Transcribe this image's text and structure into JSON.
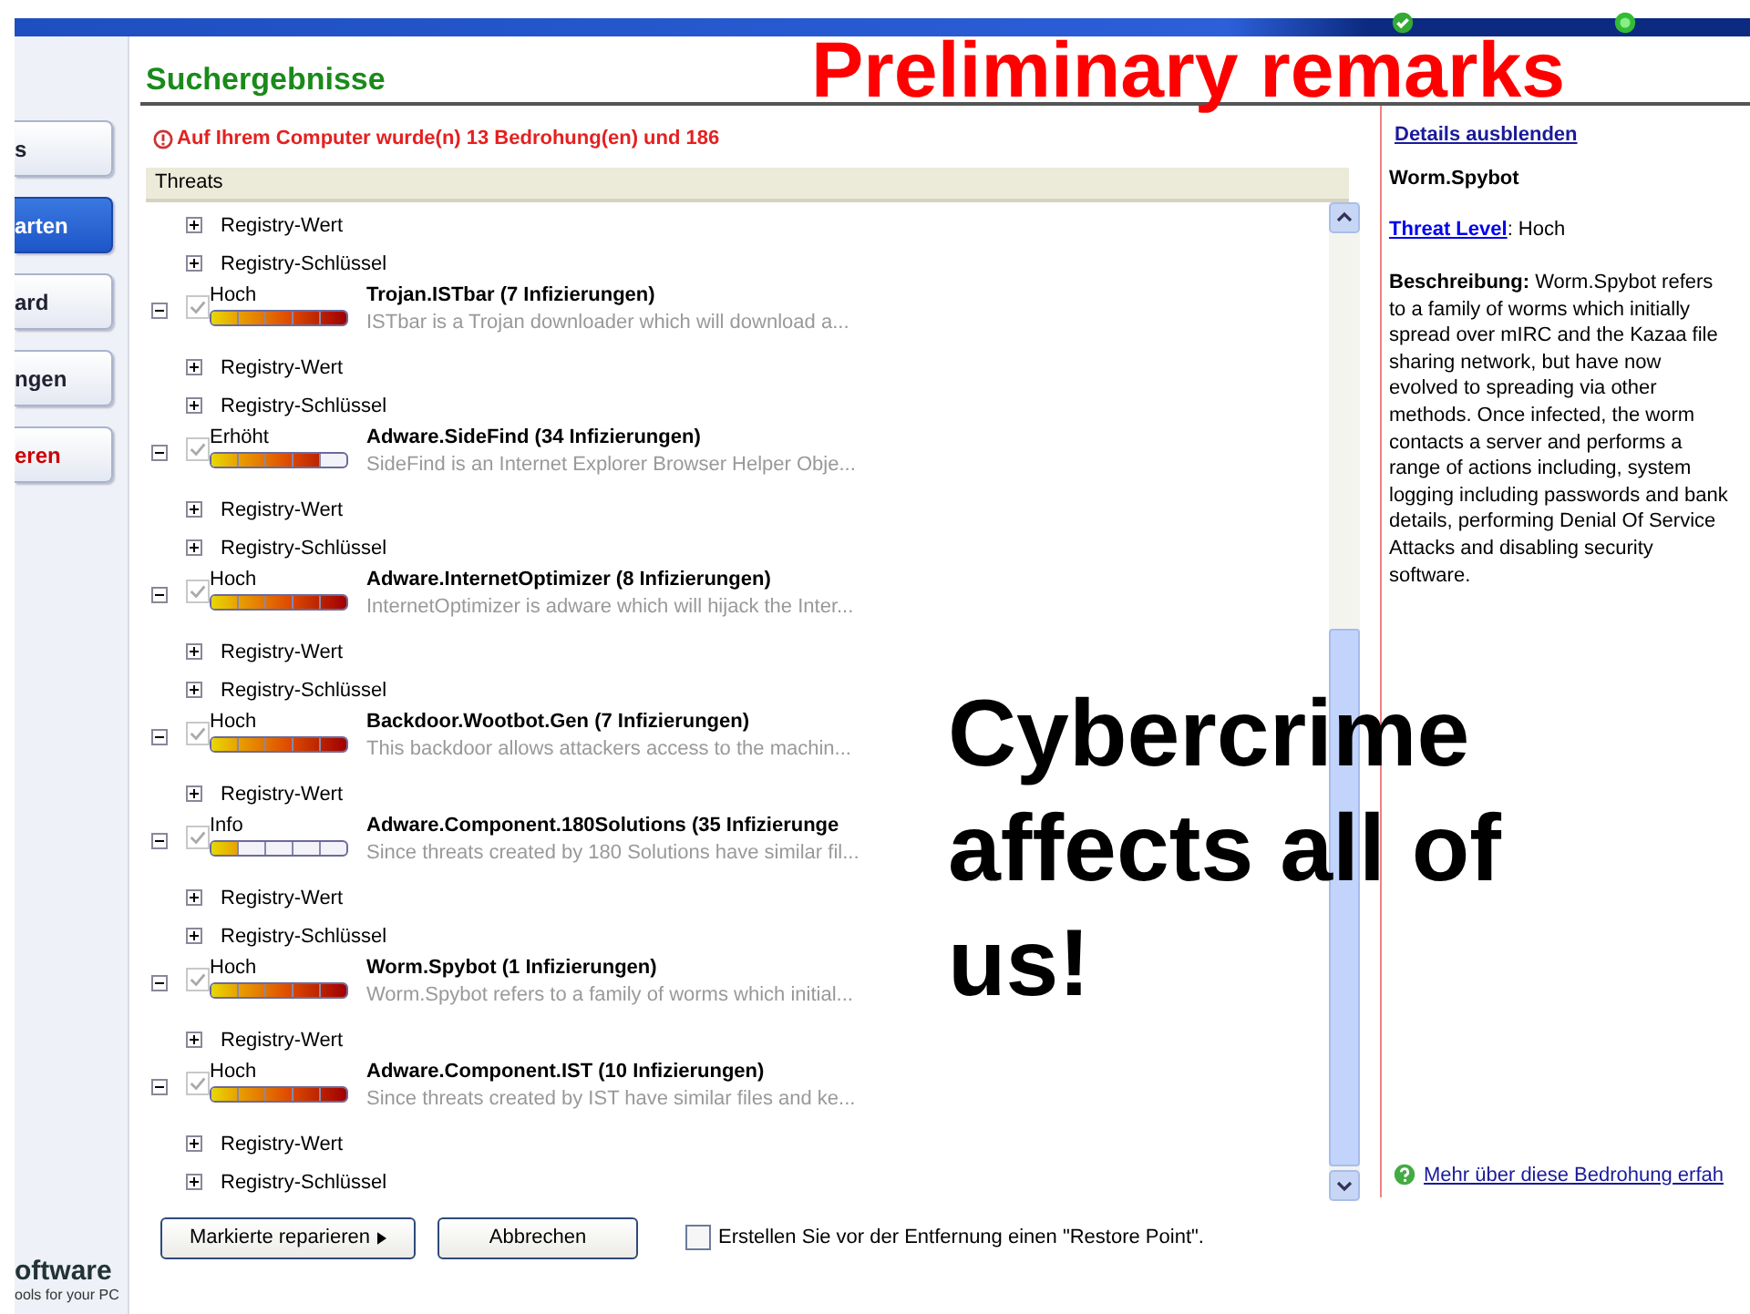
{
  "slide_title": "Preliminary remarks",
  "overlay_text": "Cybercrime affects all of us!",
  "sidebar": {
    "items": [
      {
        "label": "s",
        "selected": false,
        "kind": "normal"
      },
      {
        "label": "arten",
        "selected": true,
        "kind": "normal"
      },
      {
        "label": "ard",
        "selected": false,
        "kind": "normal"
      },
      {
        "label": "ngen",
        "selected": false,
        "kind": "normal"
      },
      {
        "label": "eren",
        "selected": false,
        "kind": "danger"
      }
    ],
    "logo": "oftware",
    "tagline": "ools for your PC"
  },
  "page_title": "Suchergebnisse",
  "warning": "Auf Ihrem Computer wurde(n) 13 Bedrohung(en) und 186",
  "table": {
    "column": "Threats",
    "rows": [
      {
        "kind": "registry",
        "label": "Registry-Wert"
      },
      {
        "kind": "registry",
        "label": "Registry-Schlüssel"
      },
      {
        "kind": "threat",
        "checked": true,
        "severity": "Hoch",
        "level": 1,
        "name": "Trojan.ISTbar (7 Infizierungen)",
        "description": "ISTbar is a Trojan downloader which will download a..."
      },
      {
        "kind": "registry",
        "label": "Registry-Wert"
      },
      {
        "kind": "registry",
        "label": "Registry-Schlüssel"
      },
      {
        "kind": "threat",
        "checked": true,
        "severity": "Erhöht",
        "level": 0.8,
        "name": "Adware.SideFind (34 Infizierungen)",
        "description": "SideFind is an Internet Explorer Browser Helper Obje..."
      },
      {
        "kind": "registry",
        "label": "Registry-Wert"
      },
      {
        "kind": "registry",
        "label": "Registry-Schlüssel"
      },
      {
        "kind": "threat",
        "checked": true,
        "severity": "Hoch",
        "level": 1,
        "name": "Adware.InternetOptimizer (8 Infizierungen)",
        "description": "InternetOptimizer is adware which will hijack the Inter..."
      },
      {
        "kind": "registry",
        "label": "Registry-Wert"
      },
      {
        "kind": "registry",
        "label": "Registry-Schlüssel"
      },
      {
        "kind": "threat",
        "checked": true,
        "severity": "Hoch",
        "level": 1,
        "name": "Backdoor.Wootbot.Gen (7 Infizierungen)",
        "description": "This backdoor allows attackers access to the machin..."
      },
      {
        "kind": "registry",
        "label": "Registry-Wert"
      },
      {
        "kind": "threat",
        "checked": true,
        "severity": "Info",
        "level": 0.2,
        "name": "Adware.Component.180Solutions (35 Infizierunge",
        "description": "Since threats created by 180 Solutions have similar fil..."
      },
      {
        "kind": "registry",
        "label": "Registry-Wert"
      },
      {
        "kind": "registry",
        "label": "Registry-Schlüssel"
      },
      {
        "kind": "threat",
        "checked": true,
        "severity": "Hoch",
        "level": 1,
        "name": "Worm.Spybot (1 Infizierungen)",
        "description": "Worm.Spybot refers to a family of worms which initial..."
      },
      {
        "kind": "registry",
        "label": "Registry-Wert"
      },
      {
        "kind": "threat",
        "checked": true,
        "severity": "Hoch",
        "level": 1,
        "name": "Adware.Component.IST (10 Infizierungen)",
        "description": "Since threats created by IST have similar files and ke..."
      },
      {
        "kind": "registry",
        "label": "Registry-Wert"
      },
      {
        "kind": "registry",
        "label": "Registry-Schlüssel"
      }
    ]
  },
  "details": {
    "toggle": "Details ausblenden",
    "name": "Worm.Spybot",
    "level_link": "Threat Level",
    "level_value": ": Hoch",
    "description": "**Beschreibung:** Worm.Spybot refers to a family of worms which initially spread over mIRC and the Kazaa file sharing network, but have now evolved to spreading via other methods. Once infected, the worm contacts a server and performs a range of actions including, system logging including passwords and bank details, performing Denial Of Service Attacks and disabling security software.",
    "more_link": "Mehr über diese Bedrohung erfah"
  },
  "buttons": [
    "Markierte reparieren",
    "Abbrechen"
  ],
  "restore": {
    "checked": false,
    "label": "Erstellen Sie vor der Entfernung einen \"Restore Point\"."
  }
}
